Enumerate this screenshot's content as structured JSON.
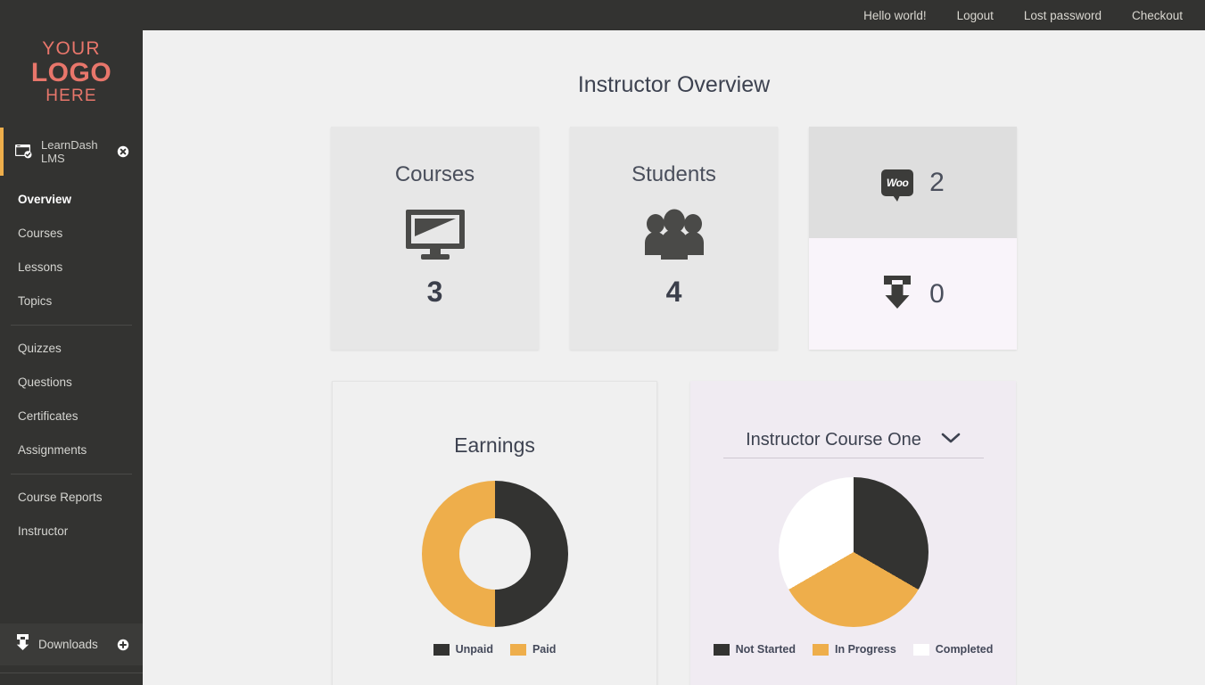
{
  "topbar": {
    "links": [
      {
        "label": "Hello world!",
        "name": "topbar-link-hello-world"
      },
      {
        "label": "Logout",
        "name": "topbar-link-logout"
      },
      {
        "label": "Lost password",
        "name": "topbar-link-lost-password"
      },
      {
        "label": "Checkout",
        "name": "topbar-link-checkout"
      }
    ]
  },
  "sidebar": {
    "logo": {
      "line1": "YOUR",
      "line2": "LOGO",
      "line3": "HERE",
      "color": "#e8766b"
    },
    "plugin": {
      "label": "LearnDash LMS",
      "icon": "learndash-icon",
      "action_icon": "close-circle-icon",
      "active_bar_color": "#eeae4b"
    },
    "menu": [
      {
        "label": "Overview",
        "active": true
      },
      {
        "label": "Courses",
        "active": false
      },
      {
        "label": "Lessons",
        "active": false
      },
      {
        "label": "Topics",
        "active": false
      },
      {
        "separator": true
      },
      {
        "label": "Quizzes",
        "active": false
      },
      {
        "label": "Questions",
        "active": false
      },
      {
        "label": "Certificates",
        "active": false
      },
      {
        "label": "Assignments",
        "active": false
      },
      {
        "separator": true
      },
      {
        "label": "Course Reports",
        "active": false
      },
      {
        "label": "Instructor",
        "active": false
      }
    ],
    "downloads": {
      "label": "Downloads",
      "icon": "download-icon",
      "action_icon": "plus-circle-icon"
    }
  },
  "main": {
    "page_title": "Instructor Overview",
    "stats": [
      {
        "title": "Courses",
        "value": "3",
        "icon": "monitor-icon"
      },
      {
        "title": "Students",
        "value": "4",
        "icon": "users-icon"
      }
    ],
    "woo_card": {
      "top": {
        "icon": "woocommerce-icon",
        "icon_text": "Woo",
        "value": "2"
      },
      "bottom": {
        "icon": "download-box-icon",
        "value": "0"
      }
    },
    "earnings_card": {
      "heading": "Earnings"
    },
    "progress_card": {
      "selected_course": "Instructor Course One",
      "dropdown_icon": "chevron-down-icon"
    }
  },
  "chart_data": [
    {
      "type": "pie",
      "title": "Earnings",
      "subtype": "donut",
      "categories": [
        "Unpaid",
        "Paid"
      ],
      "values": [
        50,
        50
      ],
      "colors": [
        "#333331",
        "#eeae4b"
      ],
      "legend_position": "bottom",
      "start_angle": 0,
      "note": "Donut split in two equal halves; Unpaid on the right half, Paid on the left half."
    },
    {
      "type": "pie",
      "title": "Instructor Course One",
      "subtype": "pie",
      "categories": [
        "Not Started",
        "In Progress",
        "Completed"
      ],
      "values": [
        33.33,
        33.33,
        33.33
      ],
      "colors": [
        "#333331",
        "#eeae4b",
        "#ffffff"
      ],
      "legend_position": "bottom",
      "start_angle": 0,
      "note": "Three equal thirds starting at 12 o'clock going clockwise."
    }
  ]
}
